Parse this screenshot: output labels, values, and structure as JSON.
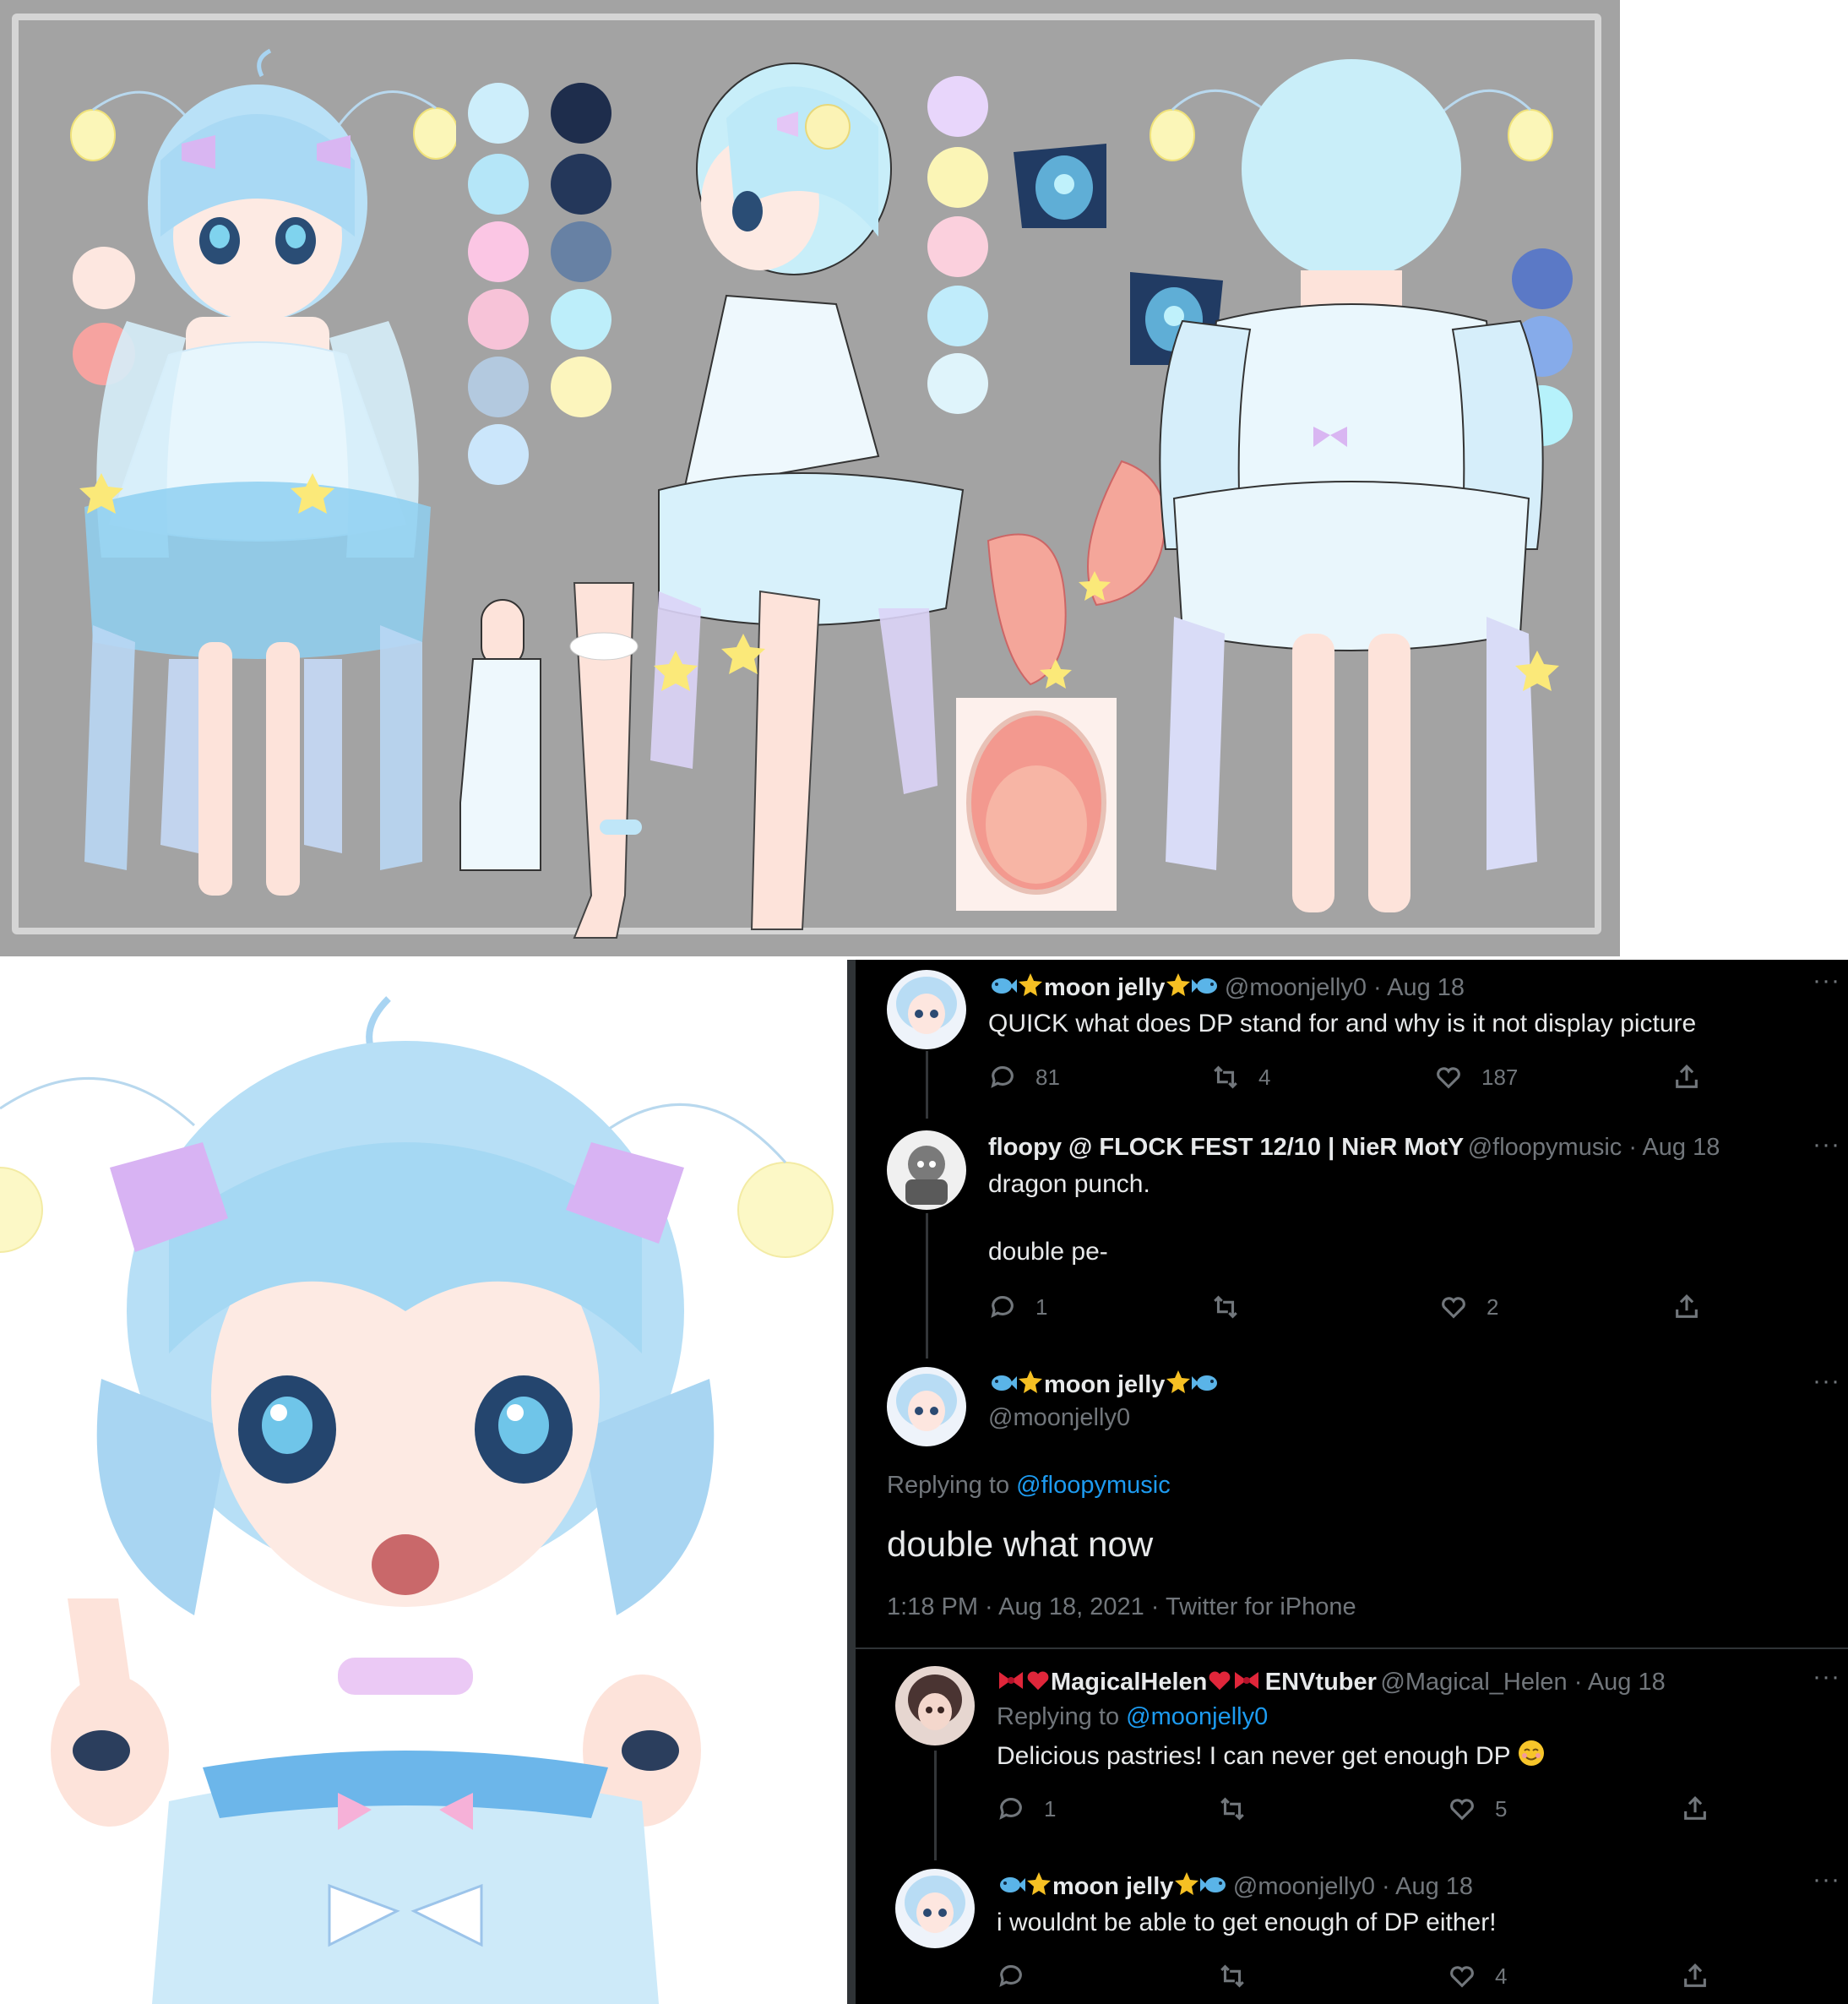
{
  "colors": {
    "sheet_bg": "#a3a3a3",
    "sheet_frame": "#d5d5d5",
    "thread_bg": "#000000",
    "link": "#1d9bf0",
    "muted": "#71767b",
    "text": "#e7e9ea"
  },
  "reference_sheet": {
    "swatch_palettes": [
      [
        "#fde7e0",
        "#f6a3a0"
      ],
      [
        "#cdeefb",
        "#b5e6f8",
        "#fbc6e4",
        "#f7c3d8",
        "#b3c9df",
        "#cbe6fb"
      ],
      [
        "#1e2d4c",
        "#24375a",
        "#6781a4",
        "#bdeefa",
        "#fcf5bd"
      ],
      [
        "#e8d6fb",
        "#fbf5b6",
        "#fbd0dd",
        "#c0ecfb",
        "#dff4fb"
      ],
      [
        "#5b79c6",
        "#86abea",
        "#b6f2fb"
      ]
    ]
  },
  "tweets": [
    {
      "display_name": "moon jelly",
      "handle": "@moonjelly0 · Aug 18",
      "text": "QUICK what does DP stand for and why is it not display picture",
      "replies": "81",
      "retweets": "4",
      "likes": "187"
    },
    {
      "display_name": "floopy @ FLOCK FEST 12/10 | NieR MotY",
      "handle": "@floopymusic · Aug 18",
      "text_line1": "dragon punch.",
      "text_line2": "double pe-",
      "replies": "1",
      "retweets": "",
      "likes": "2"
    },
    {
      "display_name": "moon jelly",
      "handle": "@moonjelly0",
      "replying_label": "Replying to",
      "replying_to": "@floopymusic",
      "text": "double what now",
      "meta": "1:18 PM · Aug 18, 2021 · Twitter for iPhone"
    },
    {
      "display_name": "MagicalHelen",
      "display_suffix": "ENVtuber",
      "handle": "@Magical_Helen · Aug 18",
      "replying_label": "Replying to",
      "replying_to": "@moonjelly0",
      "text": "Delicious pastries! I can never get enough DP",
      "replies": "1",
      "retweets": "",
      "likes": "5"
    },
    {
      "display_name": "moon jelly",
      "handle": "@moonjelly0 · Aug 18",
      "text": "i wouldnt be able to get enough of DP either!",
      "replies": "",
      "retweets": "",
      "likes": "4"
    }
  ],
  "icons": {
    "more": "···"
  }
}
